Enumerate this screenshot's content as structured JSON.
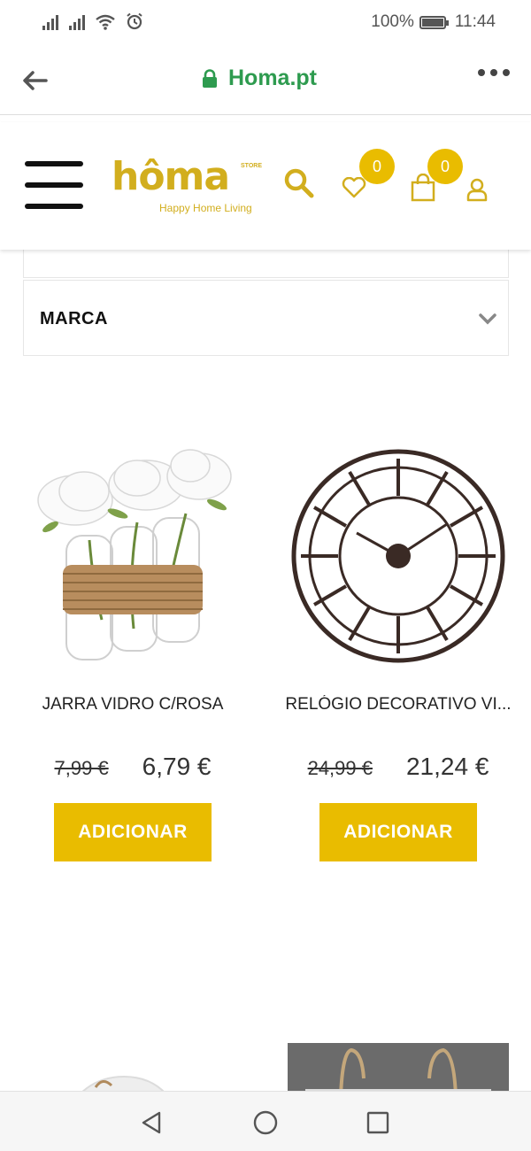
{
  "status_bar": {
    "battery_percent": "100%",
    "time": "11:44"
  },
  "browser": {
    "url": "Homa.pt"
  },
  "site": {
    "logo_word": "hôma",
    "logo_store": "STORE",
    "logo_tagline": "Happy Home Living",
    "wishlist_count": "0",
    "cart_count": "0",
    "accent_color": "#e9bc00"
  },
  "filters": {
    "marca_label": "MARCA"
  },
  "products": [
    {
      "name": "JARRA VIDRO C/ROSA",
      "old_price": "7,99 €",
      "price": "6,79 €",
      "button_label": "ADICIONAR",
      "image": "vase-with-white-roses"
    },
    {
      "name": "RELÓGIO DECORATIVO VI...",
      "old_price": "24,99 €",
      "price": "21,24 €",
      "button_label": "ADICIONAR",
      "image": "roman-numeral-wall-clock"
    }
  ]
}
